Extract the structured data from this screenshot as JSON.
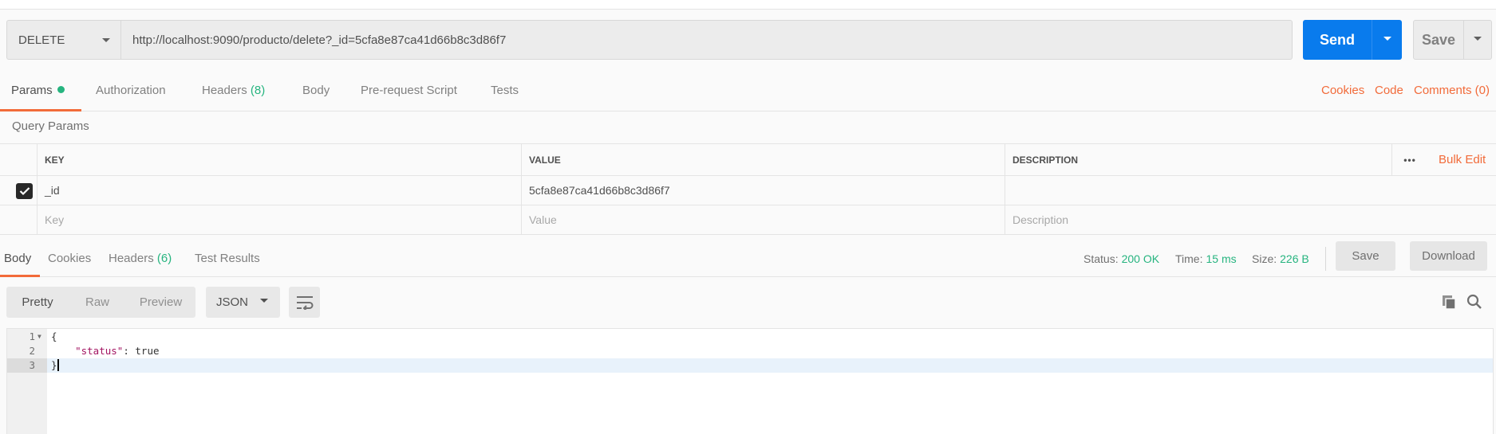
{
  "request": {
    "method": "DELETE",
    "url": "http://localhost:9090/producto/delete?_id=5cfa8e87ca41d66b8c3d86f7",
    "send_label": "Send",
    "save_label": "Save"
  },
  "request_tabs": {
    "params": "Params",
    "authorization": "Authorization",
    "headers": "Headers",
    "headers_count": "(8)",
    "body": "Body",
    "prerequest": "Pre-request Script",
    "tests": "Tests",
    "cookies": "Cookies",
    "code": "Code",
    "comments": "Comments (0)"
  },
  "query_params": {
    "title": "Query Params",
    "columns": {
      "key": "KEY",
      "value": "VALUE",
      "description": "DESCRIPTION"
    },
    "bulk_edit": "Bulk Edit",
    "rows": [
      {
        "checked": true,
        "key": "_id",
        "value": "5cfa8e87ca41d66b8c3d86f7",
        "description": ""
      }
    ],
    "placeholders": {
      "key": "Key",
      "value": "Value",
      "description": "Description"
    }
  },
  "response_tabs": {
    "body": "Body",
    "cookies": "Cookies",
    "headers": "Headers",
    "headers_count": "(6)",
    "test_results": "Test Results"
  },
  "response_meta": {
    "status_label": "Status:",
    "status_value": "200 OK",
    "time_label": "Time:",
    "time_value": "15 ms",
    "size_label": "Size:",
    "size_value": "226 B",
    "save_label": "Save",
    "download_label": "Download"
  },
  "response_view": {
    "modes": [
      "Pretty",
      "Raw",
      "Preview"
    ],
    "active_mode": "Pretty",
    "format": "JSON"
  },
  "response_body": {
    "line_numbers": [
      "1",
      "2",
      "3"
    ],
    "open_brace": "{",
    "key": "\"status\"",
    "colon": ": ",
    "value": "true",
    "close_brace": "}"
  },
  "colors": {
    "accent_orange": "#f26b3a",
    "send_blue": "#097bed",
    "success_green": "#26b47f"
  },
  "icons": [
    "chevron-down-icon",
    "checkmark-icon",
    "more-dots-icon",
    "wrap-lines-icon",
    "copy-icon",
    "search-icon",
    "fold-arrow-icon"
  ]
}
